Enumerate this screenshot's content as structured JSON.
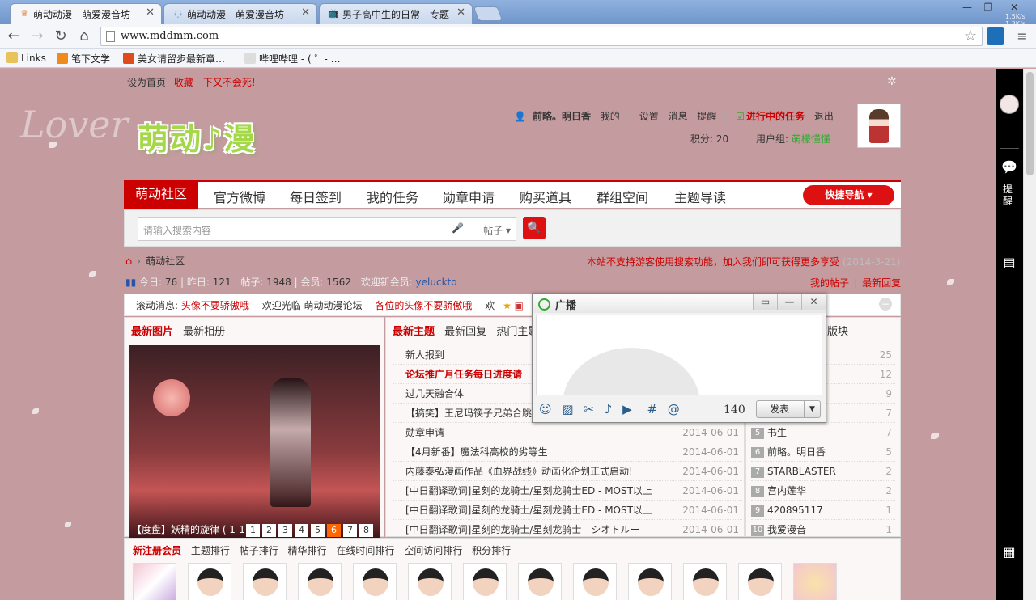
{
  "browser": {
    "tabs": [
      {
        "title": "萌动动漫 - 萌爱漫音坊",
        "active": true
      },
      {
        "title": "萌动动漫 - 萌爱漫音坊",
        "active": false
      },
      {
        "title": "男子高中生的日常 - 专题",
        "active": false
      }
    ],
    "url": "www.mddmm.com",
    "net_up": "1.5K/s",
    "net_down": "1.3K/s",
    "bookmarks": [
      "Links",
      "笔下文学",
      "美女请留步最新章…",
      "哔哩哔哩 - ( ゜- …"
    ]
  },
  "site": {
    "top_links": {
      "home": "设为首页",
      "fav": "收藏一下又不会死!"
    },
    "logo_text": "萌动♪漫",
    "logo_bg": "Lover",
    "user": {
      "name": "前略。明日香",
      "links": [
        "我的",
        "设置",
        "消息",
        "提醒"
      ],
      "task": "进行中的任务",
      "logout": "退出",
      "points_label": "积分: 20",
      "group_label": "用户组:",
      "group": "萌檬懂懂"
    },
    "nav": [
      "萌动社区",
      "官方微博",
      "每日签到",
      "我的任务",
      "勋章申请",
      "购买道具",
      "群组空间",
      "主题导读"
    ],
    "quick_nav": "快捷导航 ▾",
    "search": {
      "placeholder": "请输入搜索内容",
      "type": "帖子",
      "button": "search"
    },
    "breadcrumb": "萌动社区",
    "notice": "本站不支持游客使用搜索功能，加入我们即可获得更多享受",
    "notice_date": "(2014-3-21)",
    "stats": {
      "today_label": "今日:",
      "today": "76",
      "yesterday_label": "昨日:",
      "yesterday": "121",
      "posts_label": "帖子:",
      "posts": "1948",
      "members_label": "会员:",
      "members": "1562",
      "new_label": "欢迎新会员:",
      "new_member": "yeluckto"
    },
    "my_links": [
      "我的帖子",
      "最新回复"
    ],
    "scroll": {
      "label": "滚动消息:",
      "items": [
        "头像不要骄傲哦",
        "欢迎光临 萌动动漫论坛",
        "各位的头像不要骄傲哦",
        "欢"
      ]
    },
    "left_panel": {
      "tabs": [
        "最新图片",
        "最新相册"
      ],
      "caption": "【度盘】妖精的旋律 ( 1-1",
      "pages": [
        "1",
        "2",
        "3",
        "4",
        "5",
        "6",
        "7",
        "8"
      ],
      "current_page": "6"
    },
    "mid_panel": {
      "tabs": [
        "最新主题",
        "最新回复",
        "热门主题"
      ],
      "rows": [
        {
          "title": "新人报到",
          "date": ""
        },
        {
          "title": "论坛推广月任务每日进度请",
          "date": ""
        },
        {
          "title": "过几天融合体",
          "date": ""
        },
        {
          "title": "【搞笑】王尼玛筷子兄弟合跳",
          "date": ""
        },
        {
          "title": "勋章申请",
          "date": "2014-06-01"
        },
        {
          "title": "【4月新番】魔法科高校的劣等生",
          "date": "2014-06-01"
        },
        {
          "title": "内藤泰弘漫画作品《血界战线》动画化企划正式启动!",
          "date": "2014-06-01"
        },
        {
          "title": "[中日翻译歌词]星刻的龙骑士/星刻龙骑士ED - MOST以上",
          "date": "2014-06-01"
        },
        {
          "title": "[中日翻译歌词]星刻的龙骑士/星刻龙骑士ED - MOST以上",
          "date": "2014-06-01"
        },
        {
          "title": "[中日翻译歌词]星刻的龙骑士/星刻龙骑士 - シオトルー",
          "date": "2014-06-01"
        }
      ]
    },
    "right_panel": {
      "tab": "版块",
      "rows": [
        {
          "n": "1",
          "name": "",
          "count": "25"
        },
        {
          "n": "2",
          "name": "",
          "count": "12"
        },
        {
          "n": "3",
          "name": "",
          "count": "9"
        },
        {
          "n": "4",
          "name": "",
          "count": "7"
        },
        {
          "n": "5",
          "name": "书生",
          "count": "7"
        },
        {
          "n": "6",
          "name": "前略。明日香",
          "count": "5"
        },
        {
          "n": "7",
          "name": "STARBLASTER",
          "count": "2"
        },
        {
          "n": "8",
          "name": "宫内莲华",
          "count": "2"
        },
        {
          "n": "9",
          "name": "420895117",
          "count": "1"
        },
        {
          "n": "10",
          "name": "我爱漫音",
          "count": "1"
        }
      ]
    },
    "reg": {
      "tabs": [
        "新注册会员",
        "主题排行",
        "帖子排行",
        "精华排行",
        "在线时间排行",
        "空间访问排行",
        "积分排行"
      ]
    }
  },
  "popup": {
    "title": "广播",
    "count": "140",
    "send": "发表"
  },
  "sidebar": {
    "remind": "提醒"
  },
  "colors": {
    "accent": "#cc0000",
    "page_bg": "#c49b9e"
  }
}
